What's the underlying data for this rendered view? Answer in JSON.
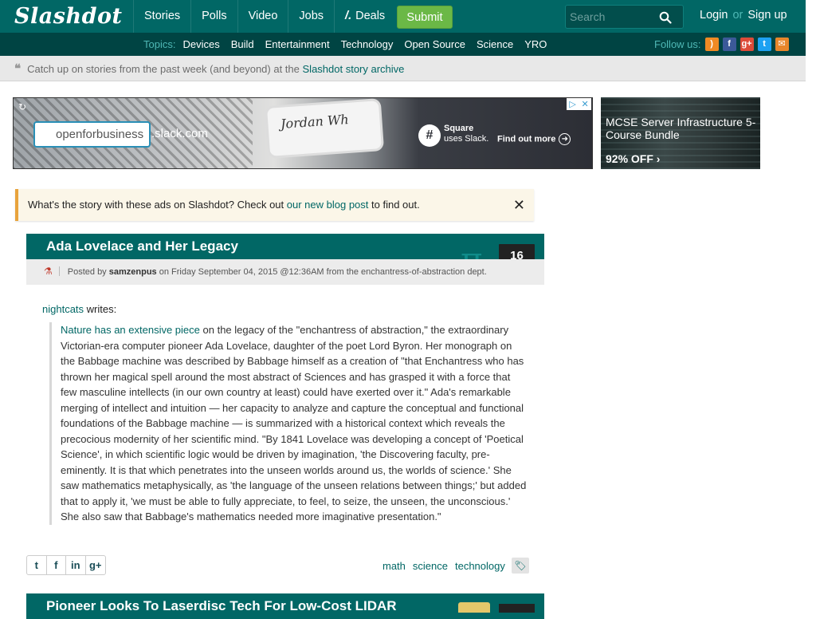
{
  "header": {
    "logo": "Slashdot",
    "nav": [
      "Stories",
      "Polls",
      "Video",
      "Jobs",
      "Deals"
    ],
    "submit": "Submit",
    "search_placeholder": "Search",
    "login": "Login",
    "or": "or",
    "signup": "Sign up"
  },
  "subnav": {
    "topics_label": "Topics:",
    "topics": [
      "Devices",
      "Build",
      "Entertainment",
      "Technology",
      "Open Source",
      "Science",
      "YRO"
    ],
    "follow_label": "Follow us:",
    "social_icons": [
      "rss-icon",
      "facebook-icon",
      "google-plus-icon",
      "twitter-icon",
      "email-icon"
    ]
  },
  "archive": {
    "text": "Catch up on stories from the past week (and beyond) at the",
    "link": "Slashdot story archive"
  },
  "ads": {
    "main": {
      "url_field": "openforbusiness",
      "domain": ".slack.com",
      "square_title": "Square",
      "square_sub": "uses Slack.",
      "cta": "Find out more"
    },
    "side": {
      "title": "MCSE Server Infrastructure 5-Course Bundle",
      "offer": "92% OFF"
    }
  },
  "notice": {
    "text": "What's the story with these ads on Slashdot? Check out",
    "link": "our new blog post",
    "suffix": "to find out."
  },
  "article": {
    "title": "Ada Lovelace and Her Legacy",
    "comments": "16",
    "posted_by_label": "Posted by",
    "author": "samzenpus",
    "date_line": "on Friday September 04, 2015 @12:36AM from the enchantress-of-abstraction dept.",
    "submitter": "nightcats",
    "writes": "writes:",
    "quote_link": "Nature has an extensive piece",
    "quote_text": "on the legacy of the \"enchantress of abstraction,\" the extraordinary Victorian-era computer pioneer Ada Lovelace, daughter of the poet Lord Byron. Her monograph on the Babbage machine was described by Babbage himself as a creation of \"that Enchantress who has thrown her magical spell around the most abstract of Sciences and has grasped it with a force that few masculine intellects (in our own country at least) could have exerted over it.\" Ada's remarkable merging of intellect and intuition — her capacity to analyze and capture the conceptual and functional foundations of the Babbage machine — is summarized with a historical context which reveals the precocious modernity of her scientific mind. \"By 1841 Lovelace was developing a concept of 'Poetical Science', in which scientific logic would be driven by imagination, 'the Discovering faculty, pre-eminently. It is that which penetrates into the unseen worlds around us, the worlds of science.' She saw mathematics metaphysically, as 'the language of the unseen relations between things;' but added that to apply it, 'we must be able to fully appreciate, to feel, to seize, the unseen, the unconscious.' She also saw that Babbage's mathematics needed more imaginative presentation.\"",
    "tags": [
      "math",
      "science",
      "technology"
    ]
  },
  "article2": {
    "title": "Pioneer Looks To Laserdisc Tech For Low-Cost LIDAR"
  },
  "colors": {
    "header_bg": "#016765",
    "subbar_bg": "#004443",
    "accent": "#016765",
    "submit_green": "#6bb846",
    "notice_bar": "#e8a33c"
  }
}
